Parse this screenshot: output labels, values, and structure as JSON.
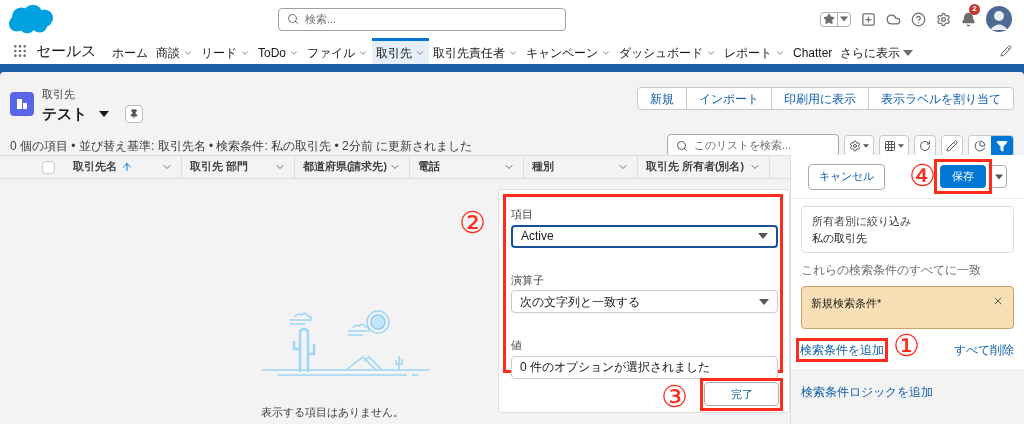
{
  "header": {
    "search_placeholder": "検索...",
    "notification_count": "2"
  },
  "nav": {
    "app_name": "セールス",
    "items": [
      {
        "label": "ホーム",
        "kind": "link",
        "selected": false
      },
      {
        "label": "商談",
        "kind": "menu",
        "selected": false
      },
      {
        "label": "リード",
        "kind": "menu",
        "selected": false
      },
      {
        "label": "ToDo",
        "kind": "menu",
        "selected": false
      },
      {
        "label": "ファイル",
        "kind": "menu",
        "selected": false
      },
      {
        "label": "取引先",
        "kind": "menu",
        "selected": true
      },
      {
        "label": "取引先責任者",
        "kind": "menu",
        "selected": false
      },
      {
        "label": "キャンペーン",
        "kind": "menu",
        "selected": false
      },
      {
        "label": "ダッシュボード",
        "kind": "menu",
        "selected": false
      },
      {
        "label": "レポート",
        "kind": "menu",
        "selected": false
      },
      {
        "label": "Chatter",
        "kind": "link",
        "selected": false
      },
      {
        "label": "さらに表示",
        "kind": "more",
        "selected": false
      }
    ]
  },
  "list_header": {
    "object": "取引先",
    "title": "テスト",
    "buttons": [
      "新規",
      "インポート",
      "印刷用に表示",
      "表示ラベルを割り当て"
    ],
    "search_placeholder": "このリストを検索...",
    "status": "0 個の項目 • 並び替え基準: 取引先名 • 検索条件: 私の取引先 • 2分前 に更新されました",
    "filter_active": true
  },
  "table": {
    "select_all_checked": false,
    "columns": [
      {
        "label": "取引先名",
        "sorted": true
      },
      {
        "label": "取引先 部門",
        "sorted": false
      },
      {
        "label": "都道府県(請求先)",
        "sorted": false
      },
      {
        "label": "電話",
        "sorted": false
      },
      {
        "label": "種別",
        "sorted": false
      },
      {
        "label": "取引先 所有者(別名)",
        "sorted": false
      }
    ],
    "empty_message": "表示する項目はありません。"
  },
  "filter_popover": {
    "annotation": "②",
    "fields": [
      {
        "label": "項目",
        "kind": "select",
        "value": "Active",
        "focused": true
      },
      {
        "label": "演算子",
        "kind": "select",
        "value": "次の文字列と一致する",
        "focused": false
      },
      {
        "label": "値",
        "kind": "text",
        "value": "0 件のオプションが選択されました",
        "focused": false
      }
    ],
    "done_button": "完了",
    "done_annotation": "③"
  },
  "filter_panel": {
    "cancel": "キャンセル",
    "save": "保存",
    "save_annotation": "④",
    "owner_filter": {
      "label": "所有者別に絞り込み",
      "value": "私の取引先"
    },
    "match_text": "これらの検索条件のすべてに一致",
    "filters": [
      {
        "label": "新規検索条件*",
        "selected": true
      }
    ],
    "add_filter": "検索条件を追加",
    "add_filter_annotation": "①",
    "remove_all": "すべて削除",
    "add_logic": "検索条件ロジックを追加"
  }
}
